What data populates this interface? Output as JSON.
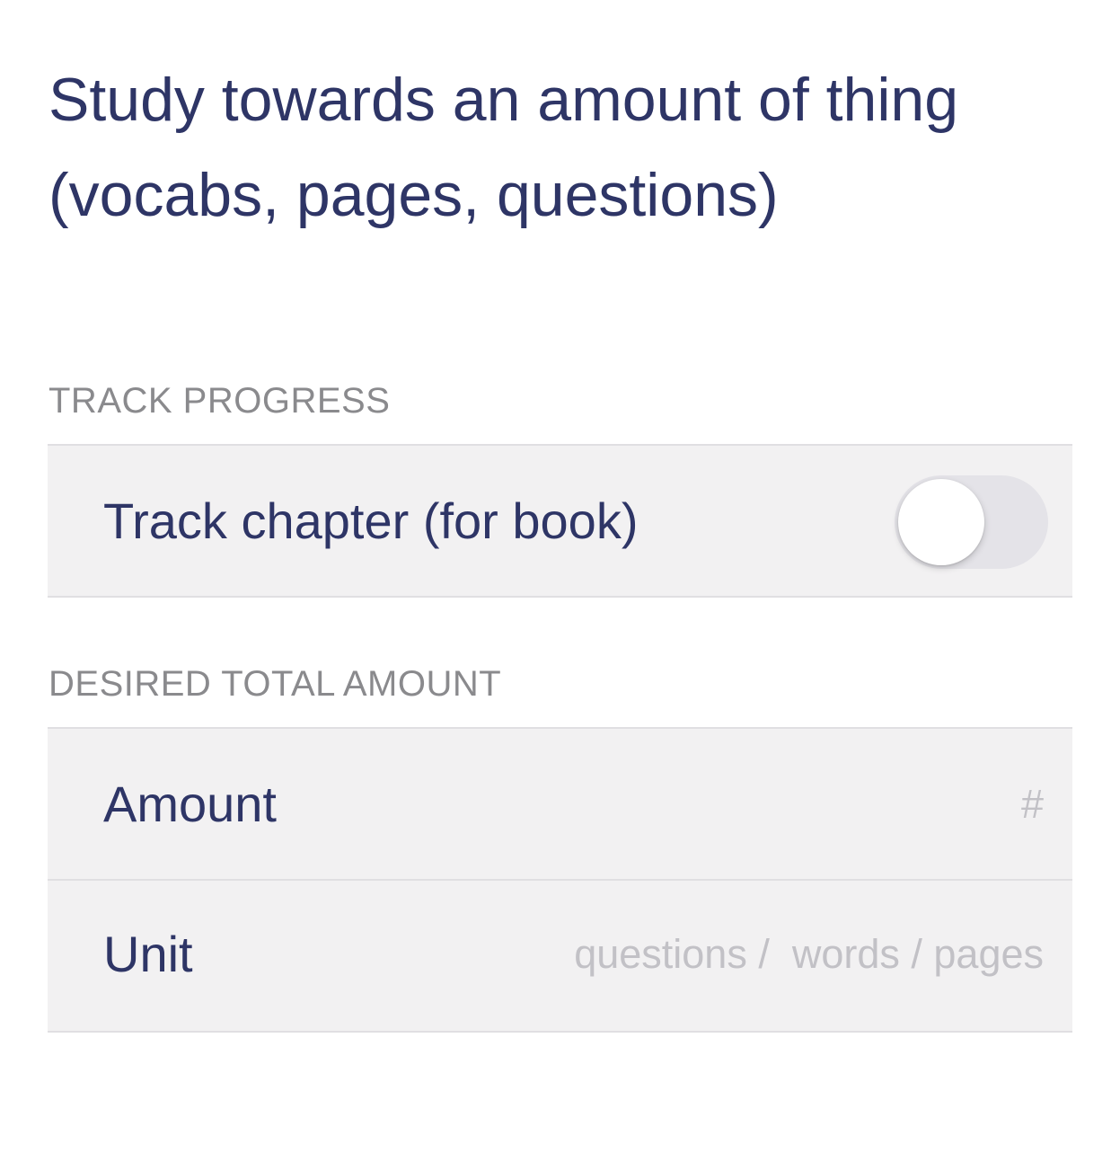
{
  "title": "Study towards an amount of thing (vocabs, pages, questions)",
  "track_progress": {
    "header": "TRACK PROGRESS",
    "track_chapter": {
      "label": "Track chapter (for book)",
      "enabled": false
    }
  },
  "desired_total_amount": {
    "header": "DESIRED TOTAL AMOUNT",
    "amount": {
      "label": "Amount",
      "value": "",
      "placeholder": "#"
    },
    "unit": {
      "label": "Unit",
      "value": "",
      "placeholder": "questions /  words / pages"
    }
  },
  "colors": {
    "text_primary": "#2e3566",
    "section_header": "#8a8a8d",
    "cell_background": "#f2f1f2",
    "placeholder": "#c2c1c6",
    "toggle_off": "#e4e3e8"
  }
}
